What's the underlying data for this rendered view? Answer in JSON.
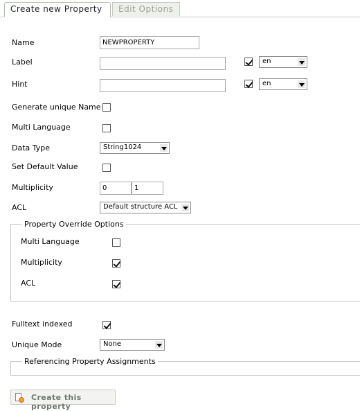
{
  "tabs": {
    "create": "Create new Property",
    "edit": "Edit Options"
  },
  "form": {
    "name": {
      "label": "Name",
      "value": "NEWPROPERTY"
    },
    "label": {
      "label": "Label",
      "value": "",
      "lang_checked": true,
      "lang": "en"
    },
    "hint": {
      "label": "Hint",
      "value": "",
      "lang_checked": true,
      "lang": "en"
    },
    "generate_unique": {
      "label": "Generate unique Name",
      "checked": false
    },
    "multi_language": {
      "label": "Multi Language",
      "checked": false
    },
    "data_type": {
      "label": "Data Type",
      "value": "String1024"
    },
    "set_default": {
      "label": "Set Default Value",
      "checked": false
    },
    "multiplicity": {
      "label": "Multiplicity",
      "min": "0",
      "max": "1"
    },
    "acl": {
      "label": "ACL",
      "value": "Default structure ACL"
    }
  },
  "override": {
    "legend": "Property Override Options",
    "multi_language": {
      "label": "Multi Language",
      "checked": false
    },
    "multiplicity": {
      "label": "Multiplicity",
      "checked": true
    },
    "acl": {
      "label": "ACL",
      "checked": true
    }
  },
  "fulltext": {
    "label": "Fulltext indexed",
    "checked": true
  },
  "unique_mode": {
    "label": "Unique Mode",
    "value": "None"
  },
  "referencing": {
    "legend": "Referencing Property Assignments"
  },
  "create_button": {
    "label": "Create this property"
  }
}
